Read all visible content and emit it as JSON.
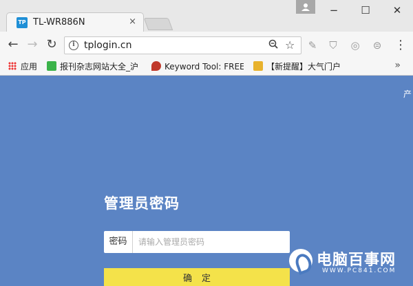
{
  "browser": {
    "tab": {
      "favicon": "TP",
      "title": "TL-WR886N",
      "close": "×"
    },
    "window": {
      "minimize": "−",
      "maximize": "☐",
      "close": "✕"
    },
    "nav": {
      "back": "←",
      "forward": "→",
      "reload": "↻"
    },
    "omnibox": {
      "url": "tplogin.cn"
    },
    "menu": "⋮"
  },
  "bookmarks": {
    "items": [
      {
        "label": "应用"
      },
      {
        "label": "报刊杂志网站大全_沪"
      },
      {
        "label": "Keyword Tool: FREE"
      },
      {
        "label": "【新提醒】大气门户"
      }
    ],
    "more": "»"
  },
  "page": {
    "corner_text": "产",
    "title": "管理员密码",
    "password": {
      "label": "密码",
      "placeholder": "请输入管理员密码"
    },
    "confirm_button": "确定"
  },
  "watermark": {
    "name": "电脑百事网",
    "url": "WWW.PC841.COM"
  },
  "colors": {
    "page_bg": "#5b84c4",
    "button": "#f4e24a",
    "favicon": "#1f8fd6"
  }
}
